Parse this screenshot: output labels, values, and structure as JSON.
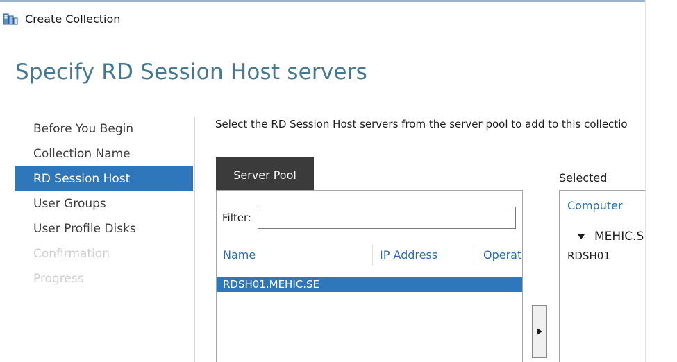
{
  "window": {
    "title": "Create Collection"
  },
  "page": {
    "title": "Specify RD Session Host servers"
  },
  "nav": {
    "items": [
      {
        "label": "Before You Begin",
        "state": "normal"
      },
      {
        "label": "Collection Name",
        "state": "normal"
      },
      {
        "label": "RD Session Host",
        "state": "active"
      },
      {
        "label": "User Groups",
        "state": "normal"
      },
      {
        "label": "User Profile Disks",
        "state": "normal"
      },
      {
        "label": "Confirmation",
        "state": "disabled"
      },
      {
        "label": "Progress",
        "state": "disabled"
      }
    ]
  },
  "main": {
    "instructions": "Select the RD Session Host servers from the server pool to add to this collectio",
    "tab_label": "Server Pool",
    "filter": {
      "label": "Filter:",
      "value": ""
    },
    "columns": [
      "Name",
      "IP Address",
      "Operat"
    ],
    "rows": [
      {
        "name": "RDSH01.MEHIC.SE",
        "selected": true
      }
    ],
    "add_button_icon": "right-arrow-icon"
  },
  "selected": {
    "label": "Selected",
    "column": "Computer",
    "group": "MEHIC.S",
    "items": [
      "RDSH01"
    ]
  },
  "colors": {
    "accent_blue": "#2f77bb",
    "title_blue": "#447792",
    "link_blue": "#2a6db5",
    "tab_dark": "#3b3b3b",
    "disabled_gray": "#cfcfcf"
  }
}
